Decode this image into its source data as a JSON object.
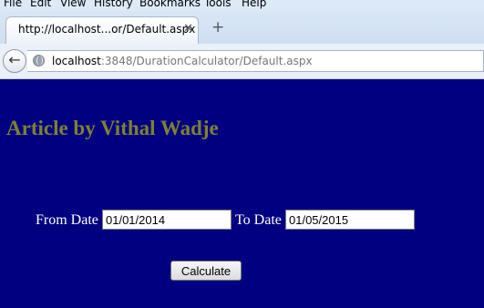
{
  "menu": [
    "File",
    "Edit",
    "View",
    "History",
    "Bookmarks",
    "Tools",
    "Help"
  ],
  "tab": {
    "title": "http://localhost...or/Default.aspx",
    "close_icon": "close-icon"
  },
  "newtab_icon": "plus-icon",
  "nav": {
    "url_host": "localhost",
    "url_rest": ":3848/DurationCalculator/Default.aspx",
    "back_icon": "back-arrow-icon",
    "site_icon": "globe-icon"
  },
  "page": {
    "heading": "Article by Vithal Wadje",
    "from_label": "From Date",
    "from_value": "01/01/2014",
    "to_label": "To Date",
    "to_value": "01/05/2015",
    "calculate_label": "Calculate",
    "heading_color": "#808032",
    "background_color": "#000080"
  }
}
